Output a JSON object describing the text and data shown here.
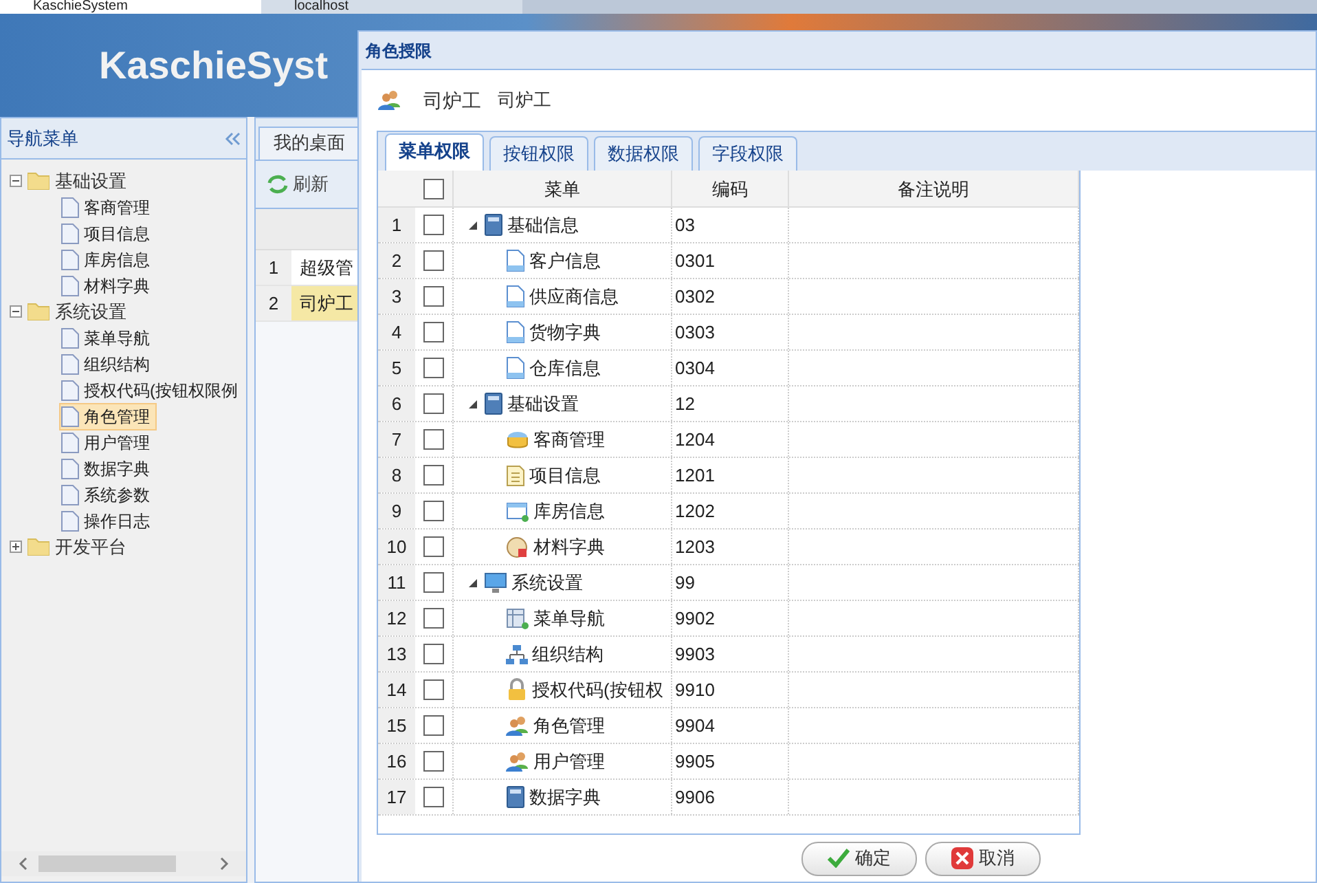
{
  "browser_tabs": [
    {
      "label": "KaschieSystem",
      "selected": true
    },
    {
      "label": "localhost",
      "selected": false
    }
  ],
  "banner": {
    "title": "KaschieSyst"
  },
  "nav": {
    "title": "导航菜单",
    "items": [
      {
        "label": "基础设置",
        "expanded": true,
        "selected": false,
        "children": [
          {
            "label": "客商管理",
            "selected": false
          },
          {
            "label": "项目信息",
            "selected": false
          },
          {
            "label": "库房信息",
            "selected": false
          },
          {
            "label": "材料字典",
            "selected": false
          }
        ]
      },
      {
        "label": "系统设置",
        "expanded": true,
        "selected": false,
        "children": [
          {
            "label": "菜单导航",
            "selected": false
          },
          {
            "label": "组织结构",
            "selected": false
          },
          {
            "label": "授权代码(按钮权限例",
            "selected": false
          },
          {
            "label": "角色管理",
            "selected": true
          },
          {
            "label": "用户管理",
            "selected": false
          },
          {
            "label": "数据字典",
            "selected": false
          },
          {
            "label": "系统参数",
            "selected": false
          },
          {
            "label": "操作日志",
            "selected": false
          }
        ]
      },
      {
        "label": "开发平台",
        "expanded": false,
        "selected": false
      }
    ]
  },
  "main": {
    "tab": "我的桌面",
    "toolbar": [
      "刷新"
    ],
    "rows": [
      {
        "num": "1",
        "name": "超级管",
        "selected": false
      },
      {
        "num": "2",
        "name": "司炉工",
        "selected": true
      }
    ]
  },
  "dialog": {
    "title": "角色授限",
    "role_name": "司炉工",
    "role_code": "司炉工",
    "tabs": [
      {
        "label": "菜单权限",
        "selected": true
      },
      {
        "label": "按钮权限",
        "selected": false
      },
      {
        "label": "数据权限",
        "selected": false
      },
      {
        "label": "字段权限",
        "selected": false
      }
    ],
    "columns": [
      "菜单",
      "编码",
      "备注说明"
    ],
    "header_checked": false,
    "rows": [
      {
        "num": "1",
        "label": "基础信息",
        "code": "03",
        "checked": false,
        "expanded": true,
        "children": [
          {
            "num": "2",
            "label": "客户信息",
            "code": "0301",
            "checked": false
          },
          {
            "num": "3",
            "label": "供应商信息",
            "code": "0302",
            "checked": false
          },
          {
            "num": "4",
            "label": "货物字典",
            "code": "0303",
            "checked": false
          },
          {
            "num": "5",
            "label": "仓库信息",
            "code": "0304",
            "checked": false
          }
        ]
      },
      {
        "num": "6",
        "label": "基础设置",
        "code": "12",
        "checked": false,
        "expanded": true,
        "children": [
          {
            "num": "7",
            "label": "客商管理",
            "code": "1204",
            "checked": false
          },
          {
            "num": "8",
            "label": "项目信息",
            "code": "1201",
            "checked": false
          },
          {
            "num": "9",
            "label": "库房信息",
            "code": "1202",
            "checked": false
          },
          {
            "num": "10",
            "label": "材料字典",
            "code": "1203",
            "checked": false
          }
        ]
      },
      {
        "num": "11",
        "label": "系统设置",
        "code": "99",
        "checked": false,
        "expanded": true,
        "children": [
          {
            "num": "12",
            "label": "菜单导航",
            "code": "9902",
            "checked": false
          },
          {
            "num": "13",
            "label": "组织结构",
            "code": "9903",
            "checked": false
          },
          {
            "num": "14",
            "label": "授权代码(按钮权",
            "code": "9910",
            "checked": false
          },
          {
            "num": "15",
            "label": "角色管理",
            "code": "9904",
            "checked": false
          },
          {
            "num": "16",
            "label": "用户管理",
            "code": "9905",
            "checked": false
          },
          {
            "num": "17",
            "label": "数据字典",
            "code": "9906",
            "checked": false
          }
        ]
      }
    ],
    "buttons": [
      {
        "label": "确定",
        "kind": "ok"
      },
      {
        "label": "取消",
        "kind": "cancel"
      }
    ]
  }
}
